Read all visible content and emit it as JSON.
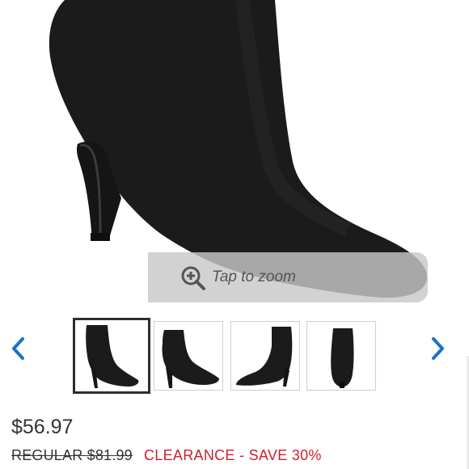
{
  "product": {
    "image_alt": "Black suede pointed-toe stiletto ankle bootie",
    "zoom_hint": "Tap to zoom"
  },
  "gallery": {
    "thumbnails": [
      {
        "name": "Side view",
        "selected": true
      },
      {
        "name": "Outer side view",
        "selected": false
      },
      {
        "name": "Inner side view",
        "selected": false
      },
      {
        "name": "Back view",
        "selected": false
      }
    ],
    "prev_icon": "chevron-left-icon",
    "next_icon": "chevron-right-icon",
    "accent_color": "#1a73c8"
  },
  "pricing": {
    "sale_price": "$56.97",
    "regular_price": "REGULAR $81.99",
    "clearance_label": "CLEARANCE - SAVE 30%",
    "clearance_color": "#cc1f2c"
  }
}
